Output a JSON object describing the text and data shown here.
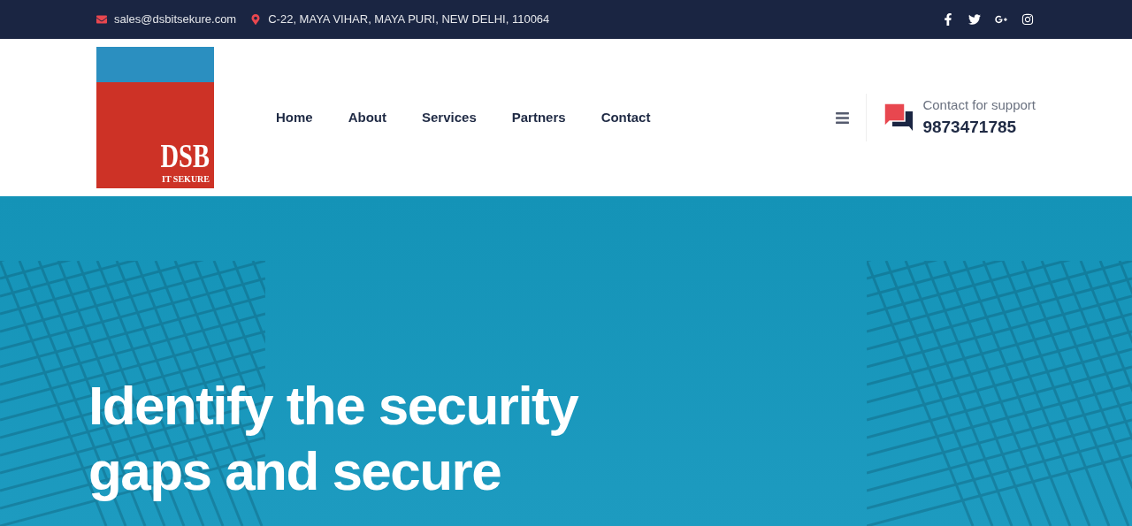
{
  "top_bar": {
    "email": "sales@dsbitsekure.com",
    "address": "C-22, MAYA VIHAR, MAYA PURI, NEW DELHI, 110064",
    "social": [
      {
        "kind": "facebook"
      },
      {
        "kind": "twitter"
      },
      {
        "kind": "google-plus"
      },
      {
        "kind": "instagram"
      }
    ]
  },
  "logo": {
    "title": "DSB",
    "subtitle": "IT SEKURE"
  },
  "nav": [
    {
      "label": "Home"
    },
    {
      "label": "About"
    },
    {
      "label": "Services"
    },
    {
      "label": "Partners"
    },
    {
      "label": "Contact"
    }
  ],
  "support": {
    "label": "Contact for support",
    "phone": "9873471785"
  },
  "hero": {
    "heading_lines": [
      "Identify the security",
      "gaps and secure"
    ]
  }
}
